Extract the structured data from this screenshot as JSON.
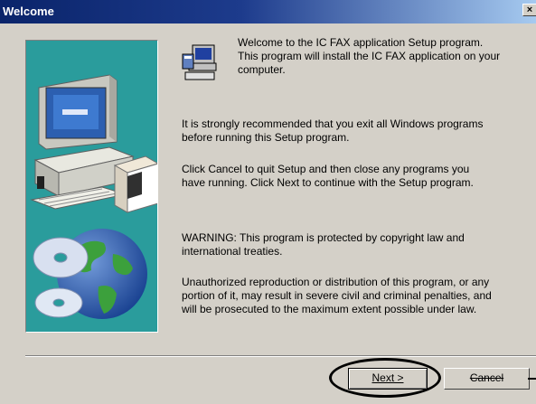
{
  "window": {
    "title": "Welcome",
    "close_glyph": "×"
  },
  "intro_text": "Welcome to the IC FAX application Setup program.\nThis program will install the IC FAX application on your\ncomputer.",
  "recommend_text": "It is strongly recommended that you exit all Windows programs\nbefore running this Setup program.",
  "cancel_info_text": "Click Cancel to quit Setup and then close any programs you\nhave running.  Click Next to continue with the Setup program.",
  "warning_text": "WARNING: This program is protected by copyright law and\ninternational treaties.",
  "unauthorized_text": "Unauthorized reproduction or distribution of this program, or any\nportion of it, may result in severe civil and criminal penalties, and\nwill be prosecuted to the maximum extent possible under law.",
  "buttons": {
    "next": "Next >",
    "cancel": "Cancel"
  },
  "colors": {
    "titlebar_start": "#0a246a",
    "titlebar_end": "#a6caf0",
    "side_panel": "#2a9c9c",
    "dialog_bg": "#d4d0c8"
  },
  "icons": {
    "setup": "setup-computer-icon",
    "panel_art": "computer-globe-cd-illustration"
  }
}
